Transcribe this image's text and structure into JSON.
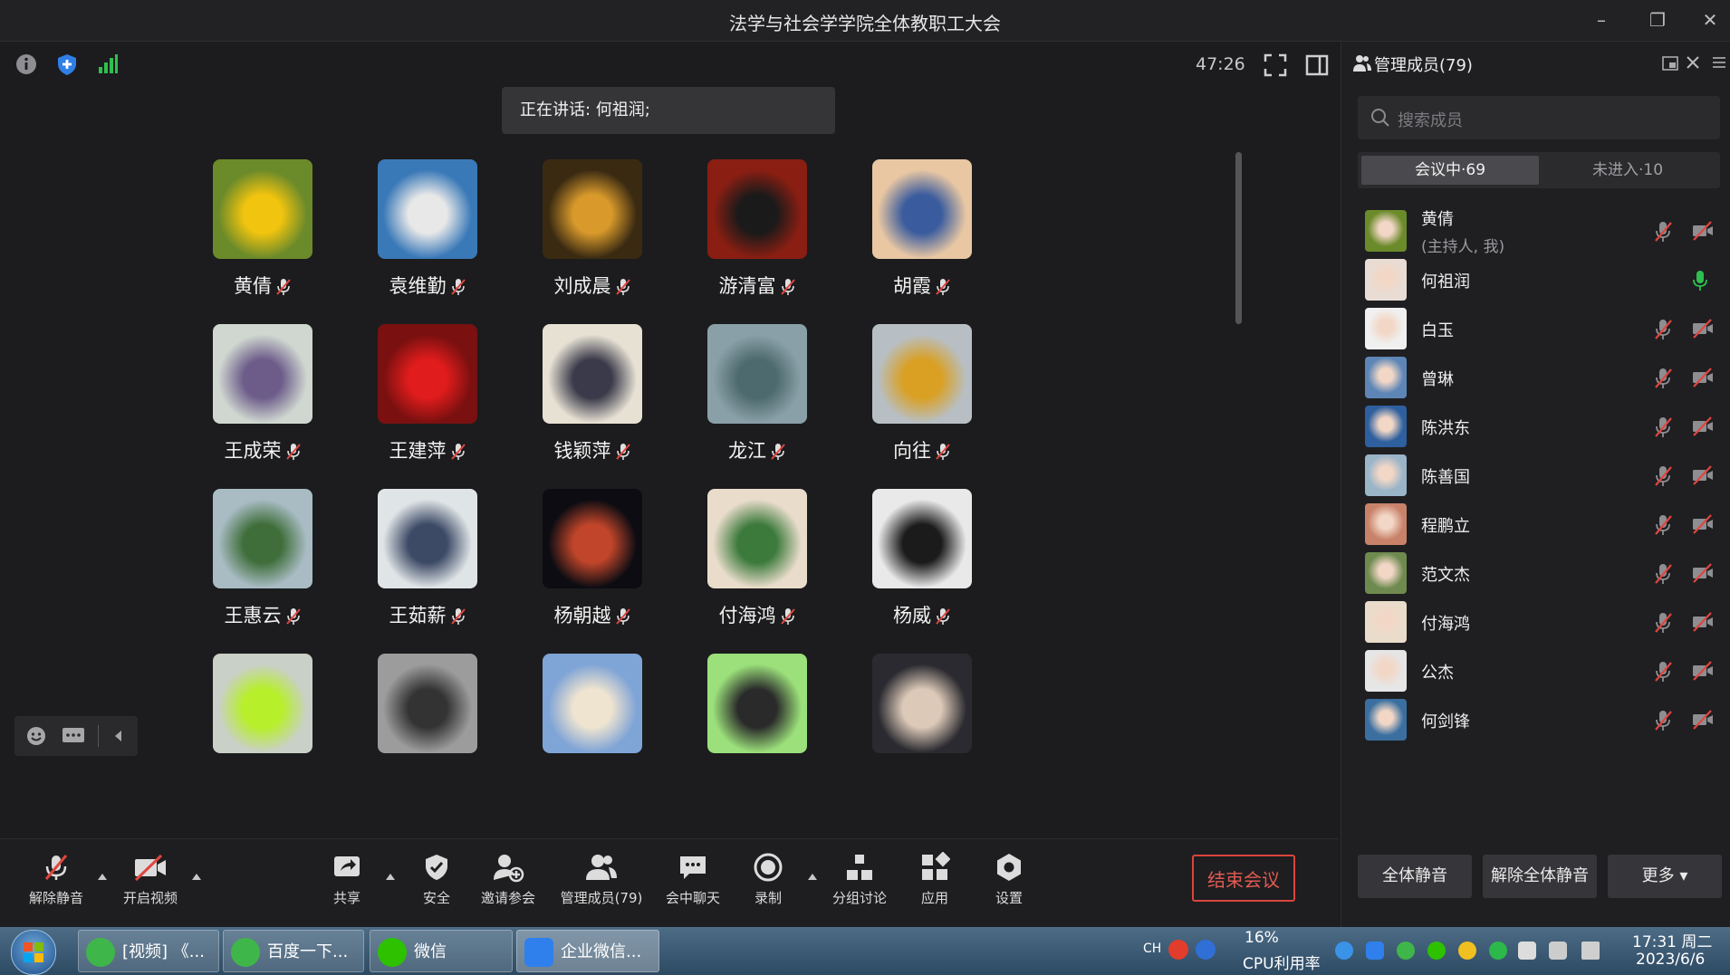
{
  "window": {
    "title": "法学与社会学学院全体教职工大会"
  },
  "header": {
    "timer": "47:26"
  },
  "speaking": "正在讲话: 何祖润;",
  "tiles": [
    {
      "name": "黄倩",
      "bg": "#6b8a2a",
      "accent": "#f1c40f"
    },
    {
      "name": "袁维勤",
      "bg": "#3a79b8",
      "accent": "#e8e8e8"
    },
    {
      "name": "刘成晨",
      "bg": "#3a2a12",
      "accent": "#d99a2b"
    },
    {
      "name": "游清富",
      "bg": "#8a1e12",
      "accent": "#1a1a1a"
    },
    {
      "name": "胡霞",
      "bg": "#e9c7a3",
      "accent": "#3a5c9e"
    },
    {
      "name": "王成荣",
      "bg": "#cfd7d0",
      "accent": "#6d5c8a"
    },
    {
      "name": "王建萍",
      "bg": "#7a1010",
      "accent": "#e01c1c"
    },
    {
      "name": "钱颖萍",
      "bg": "#e7e1d4",
      "accent": "#3a3a4a"
    },
    {
      "name": "龙江",
      "bg": "#8aa0a8",
      "accent": "#4d6a6e"
    },
    {
      "name": "向往",
      "bg": "#b8bfc4",
      "accent": "#d9a024"
    },
    {
      "name": "王惠云",
      "bg": "#a9bcc4",
      "accent": "#3f6e3a"
    },
    {
      "name": "王茹薪",
      "bg": "#dfe4e6",
      "accent": "#3d4a66"
    },
    {
      "name": "杨朝越",
      "bg": "#0c0c12",
      "accent": "#c0452a"
    },
    {
      "name": "付海鸿",
      "bg": "#e9dccb",
      "accent": "#3c7a3c"
    },
    {
      "name": "杨威",
      "bg": "#e9e9ea",
      "accent": "#1b1b1b"
    },
    {
      "name": "",
      "bg": "#c9d0c7",
      "accent": "#b7ef2a"
    },
    {
      "name": "",
      "bg": "#9c9c9c",
      "accent": "#333333"
    },
    {
      "name": "",
      "bg": "#7fa4d6",
      "accent": "#efe4d0"
    },
    {
      "name": "",
      "bg": "#9be07a",
      "accent": "#2a2a2a"
    },
    {
      "name": "",
      "bg": "#2a2a30",
      "accent": "#dcc9b8"
    }
  ],
  "toolbar": {
    "unmute": "解除静音",
    "video": "开启视频",
    "share": "共享",
    "security": "安全",
    "invite": "邀请参会",
    "members": "管理成员(79)",
    "chat": "会中聊天",
    "record": "录制",
    "breakout": "分组讨论",
    "apps": "应用",
    "settings": "设置",
    "end": "结束会议"
  },
  "panel": {
    "title": "管理成员(79)",
    "search_placeholder": "搜索成员",
    "tab_in": "会议中·69",
    "tab_out": "未进入·10",
    "mute_all": "全体静音",
    "unmute_all": "解除全体静音",
    "more": "更多 ▾"
  },
  "members": [
    {
      "name": "黄倩",
      "sub": "(主持人, 我)",
      "bg": "#6b8a2a",
      "mic": "off"
    },
    {
      "name": "何祖润",
      "sub": "",
      "bg": "#e8dcd4",
      "mic": "on"
    },
    {
      "name": "白玉",
      "sub": "",
      "bg": "#f0f0f0",
      "mic": "off"
    },
    {
      "name": "曾琳",
      "sub": "",
      "bg": "#5d86b6",
      "mic": "off"
    },
    {
      "name": "陈洪东",
      "sub": "",
      "bg": "#2e5f9e",
      "mic": "off"
    },
    {
      "name": "陈善国",
      "sub": "",
      "bg": "#9ab4c8",
      "mic": "off"
    },
    {
      "name": "程鹏立",
      "sub": "",
      "bg": "#c9826a",
      "mic": "off"
    },
    {
      "name": "范文杰",
      "sub": "",
      "bg": "#6e8a4f",
      "mic": "off"
    },
    {
      "name": "付海鸿",
      "sub": "",
      "bg": "#e9dccb",
      "mic": "off"
    },
    {
      "name": "公杰",
      "sub": "",
      "bg": "#e6e6e6",
      "mic": "off"
    },
    {
      "name": "何剑锋",
      "sub": "",
      "bg": "#3a6fa0",
      "mic": "off"
    }
  ],
  "taskbar": {
    "items": [
      "[视频] 《...",
      "百度一下...",
      "微信",
      "企业微信..."
    ],
    "lang": "CH",
    "cpu_pct": "16%",
    "cpu_label": "CPU利用率",
    "time": "17:31 周二",
    "date": "2023/6/6"
  }
}
